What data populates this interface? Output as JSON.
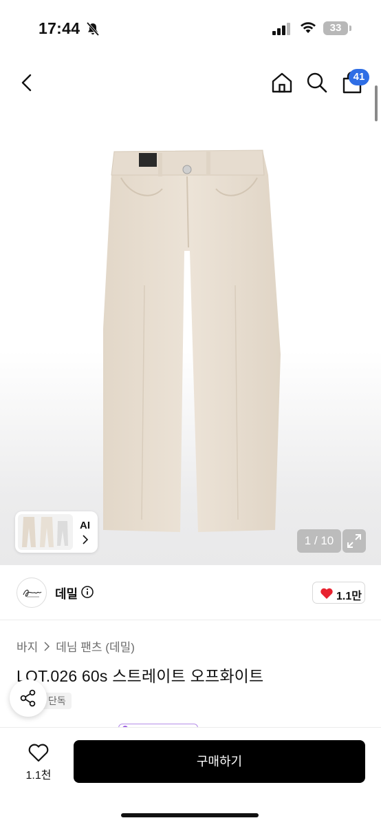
{
  "status_bar": {
    "time": "17:44",
    "battery": "33"
  },
  "top_nav": {
    "cart_badge": "41"
  },
  "gallery": {
    "thumb_label": "AI",
    "pager": "1 / 10"
  },
  "brand": {
    "name": "데밀",
    "likes": "1.1만"
  },
  "product": {
    "breadcrumb": [
      "바지",
      "데님 팬츠 (데밀)"
    ],
    "title": "LOT.026 60s 스트레이트 오프화이트",
    "tag": "단독"
  },
  "bottom_bar": {
    "wish_count": "1.1천",
    "buy_label": "구매하기"
  },
  "colors": {
    "accent_blue": "#2f6ee5",
    "heart_red": "#e8222f",
    "buy_black": "#000000",
    "pants_ecru": "#e7ddd0"
  }
}
